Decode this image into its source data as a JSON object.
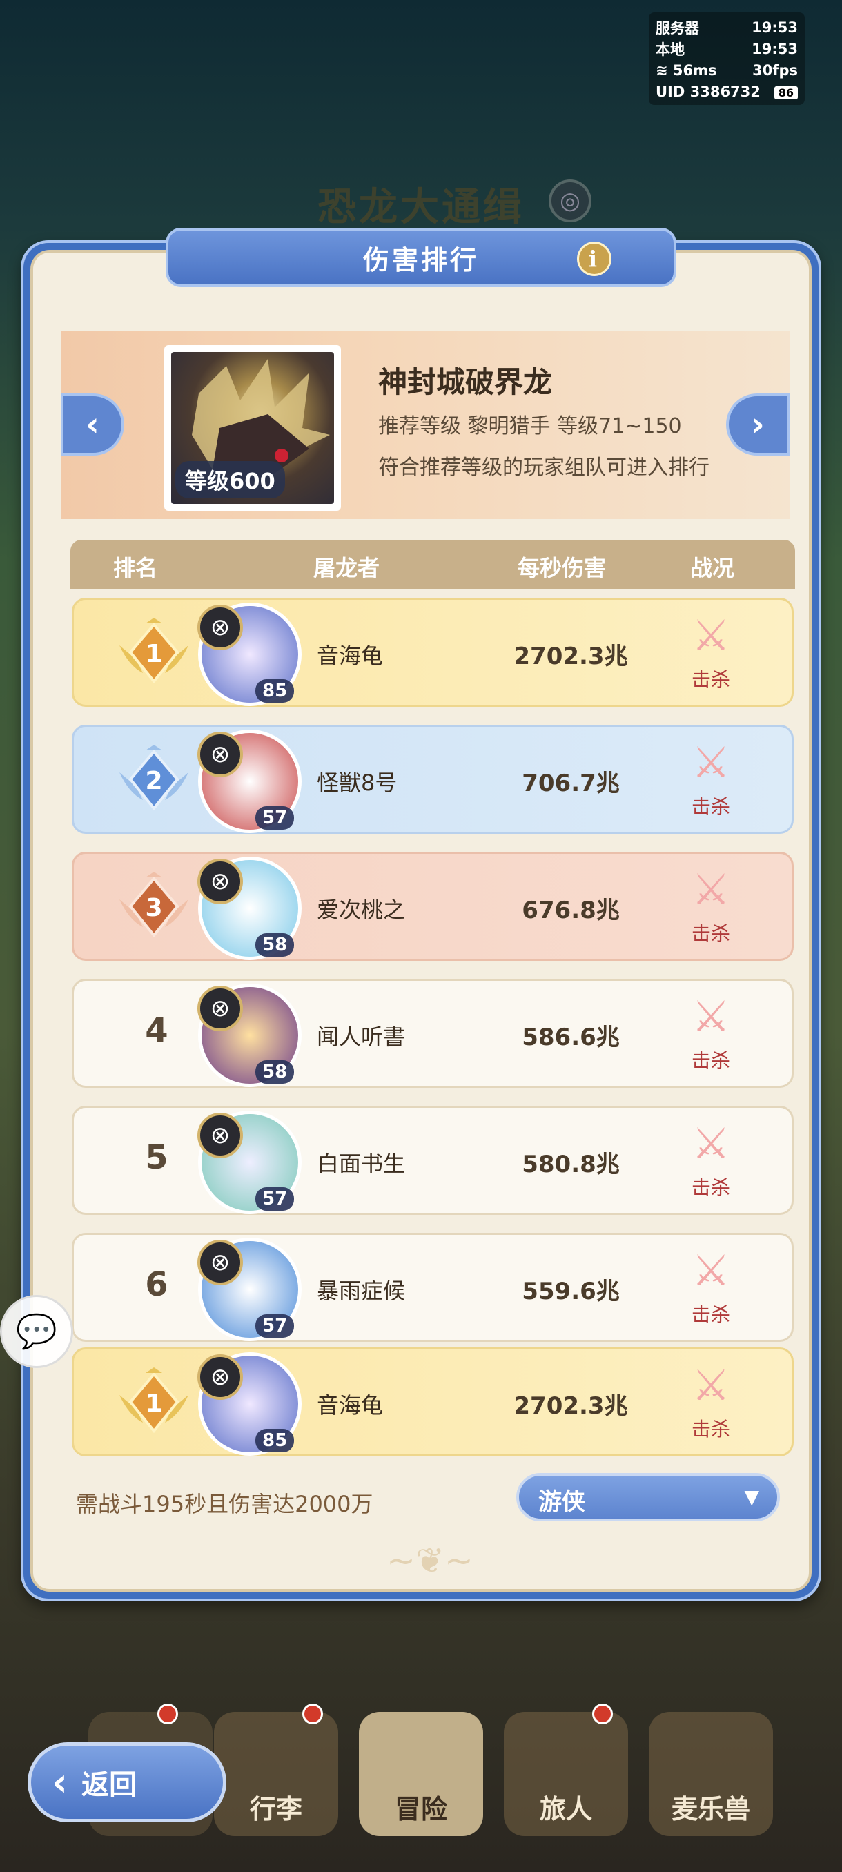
{
  "status": {
    "server_label": "服务器",
    "server_time": "19:53",
    "local_label": "本地",
    "local_time": "19:53",
    "ping": "56ms",
    "fps": "30fps",
    "uid": "UID 3386732",
    "battery": "86"
  },
  "background": {
    "title": "恐龙大通缉"
  },
  "panel": {
    "title": "伤害排行"
  },
  "boss": {
    "name": "神封城破界龙",
    "level": "等级600",
    "recommend": "推荐等级  黎明猎手  等级71~150",
    "note": "符合推荐等级的玩家组队可进入排行"
  },
  "table": {
    "headers": {
      "rank": "排名",
      "slayer": "屠龙者",
      "dps": "每秒伤害",
      "result": "战况"
    }
  },
  "rows": [
    {
      "rank": "1",
      "name": "音海龟",
      "level": "85",
      "dps": "2702.3兆",
      "result": "击杀",
      "tier": "gold"
    },
    {
      "rank": "2",
      "name": "怪獣8号",
      "level": "57",
      "dps": "706.7兆",
      "result": "击杀",
      "tier": "silver"
    },
    {
      "rank": "3",
      "name": "爱次桃之",
      "level": "58",
      "dps": "676.8兆",
      "result": "击杀",
      "tier": "bronze"
    },
    {
      "rank": "4",
      "name": "闻人听書",
      "level": "58",
      "dps": "586.6兆",
      "result": "击杀",
      "tier": "plain"
    },
    {
      "rank": "5",
      "name": "白面书生",
      "level": "57",
      "dps": "580.8兆",
      "result": "击杀",
      "tier": "plain"
    },
    {
      "rank": "6",
      "name": "暴雨症候",
      "level": "57",
      "dps": "559.6兆",
      "result": "击杀",
      "tier": "plain"
    }
  ],
  "self_row": {
    "rank": "1",
    "name": "音海龟",
    "level": "85",
    "dps": "2702.3兆",
    "result": "击杀"
  },
  "requirement": "需战斗195秒且伤害达2000万",
  "job_select": {
    "value": "游侠"
  },
  "nav": {
    "back": "返回",
    "tabs": [
      "行李",
      "冒险",
      "旅人",
      "麦乐兽"
    ]
  },
  "colors": {
    "accent": "#4a73c4",
    "gold": "#fbe7a6",
    "silver": "#cfe3f6",
    "bronze": "#f6d4c4"
  }
}
